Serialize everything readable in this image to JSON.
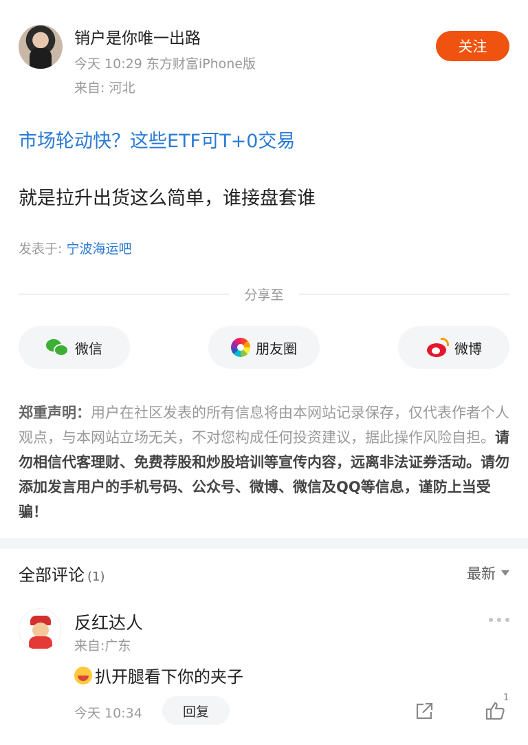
{
  "post": {
    "username": "销户是你唯一出路",
    "meta": "今天 10:29 东方财富iPhone版",
    "from": "来自: 河北",
    "follow_label": "关注",
    "title": "市场轮动快？这些ETF可T+0交易",
    "body": "就是拉升出货这么简单，谁接盘套谁",
    "posted_in_label": "发表于: ",
    "posted_in_bar": "宁波海运吧"
  },
  "share": {
    "label": "分享至",
    "wechat": "微信",
    "moments": "朋友圈",
    "weibo": "微博"
  },
  "disclaimer": {
    "label": "郑重声明：",
    "normal": "用户在社区发表的所有信息将由本网站记录保存，仅代表作者个人观点，与本网站立场无关，不对您构成任何投资建议，据此操作风险自担。",
    "bold": "请勿相信代客理财、免费荐股和炒股培训等宣传内容，远离非法证券活动。请勿添加发言用户的手机号码、公众号、微博、微信及QQ等信息，谨防上当受骗！"
  },
  "comments": {
    "title": "全部评论",
    "count": "(1)",
    "sort": "最新",
    "items": [
      {
        "name": "反红达人",
        "from": "来自:广东",
        "text": "扒开腿看下你的夹子",
        "time": "今天 10:34",
        "reply_label": "回复",
        "likes": "1"
      }
    ]
  },
  "colors": {
    "accent": "#f0530f",
    "link": "#2a7ad5"
  }
}
